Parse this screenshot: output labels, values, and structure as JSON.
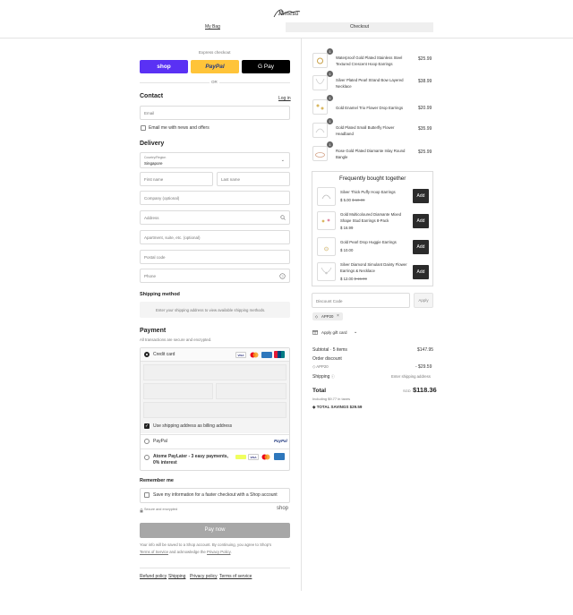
{
  "header": {
    "logo_text": "Kimesa",
    "tab_bag": "My Bag",
    "tab_checkout": "Checkout"
  },
  "express": {
    "label": "Express checkout",
    "shop": "shop",
    "paypal": "PayPal",
    "gpay": "G Pay",
    "or": "OR"
  },
  "contact": {
    "title": "Contact",
    "login": "Log in",
    "email_ph": "Email",
    "news_label": "Email me with news and offers"
  },
  "delivery": {
    "title": "Delivery",
    "country_label": "Country/Region",
    "country_value": "Singapore",
    "first_ph": "First name",
    "last_ph": "Last name",
    "company_ph": "Company (optional)",
    "address_ph": "Address",
    "apt_ph": "Apartment, suite, etc. (optional)",
    "postal_ph": "Postal code",
    "phone_ph": "Phone"
  },
  "shipping": {
    "title": "Shipping method",
    "note": "Enter your shipping address to view available shipping methods."
  },
  "payment": {
    "title": "Payment",
    "subtitle": "All transactions are secure and encrypted.",
    "credit_card": "Credit card",
    "billing_same": "Use shipping address as billing address",
    "paypal": "PayPal",
    "paypal_logo": "PayPal",
    "atome": "Atome PayLater - 3 easy payments, 0% interest"
  },
  "remember": {
    "title": "Remember me",
    "save_label": "Save my information for a faster checkout with a Shop account",
    "secure": "Secure and encrypted",
    "shop_logo": "shop"
  },
  "pay_button": "Pay now",
  "legal": {
    "line1": "Your info will be saved to a Shop account. By continuing, you agree to Shop's",
    "terms": "Terms of Service",
    "and": "and acknowledge the",
    "privacy": "Privacy Policy",
    "dot": "."
  },
  "footer_links": [
    "Refund policy",
    "Shipping",
    "Privacy policy",
    "Terms of service"
  ],
  "order_items": [
    {
      "qty": "1",
      "name": "Waterproof Gold Plated Stainless Steel Textured Crescent Hoop Earrings",
      "price": "$25.99"
    },
    {
      "qty": "1",
      "name": "Silver Plated Pearl Strand Bow Layered Necklace",
      "price": "$38.99"
    },
    {
      "qty": "1",
      "name": "Gold Enamel Trio Flower Drop Earrings",
      "price": "$20.99"
    },
    {
      "qty": "1",
      "name": "Gold Plated Small Butterfly Flower Headband",
      "price": "$35.99"
    },
    {
      "qty": "1",
      "name": "Rose Gold Plated Diamante Inlay Round Bangle",
      "price": "$25.99"
    }
  ],
  "fbt": {
    "title": "Frequently bought together",
    "add_label": "Add",
    "items": [
      {
        "name": "Silver Thick Puffy Hoop Earrings",
        "price": "$ 5.00",
        "old": "$ 10.99"
      },
      {
        "name": "Gold Multicoloured Diamante Mixed Shape Stud Earrings 8-Pack",
        "price": "$ 16.99",
        "old": ""
      },
      {
        "name": "Gold Pearl Drop Huggie Earrings",
        "price": "$ 10.00",
        "old": ""
      },
      {
        "name": "Silver Diamond Simulant Dainty Flower Earrings & Necklace",
        "price": "$ 12.00",
        "old": "$ 15.99"
      }
    ]
  },
  "discount": {
    "placeholder": "Discount Code",
    "apply": "Apply",
    "code": "APP20",
    "gift": "Apply gift card"
  },
  "summary": {
    "subtotal_label": "Subtotal · 5 items",
    "subtotal": "$147.95",
    "order_discount": "Order discount",
    "code": "APP20",
    "discount_value": "- $29.59",
    "shipping_label": "Shipping",
    "shipping_value": "Enter shipping address",
    "total_label": "Total",
    "currency": "SGD",
    "total": "$118.36",
    "taxes": "Including $9.77 in taxes",
    "savings_label": "TOTAL SAVINGS",
    "savings": "$29.59"
  },
  "colors": {
    "shop": "#5a31f4",
    "paypal": "#ffc439",
    "gpay": "#000000",
    "pay_button": "#a7a7a7"
  }
}
